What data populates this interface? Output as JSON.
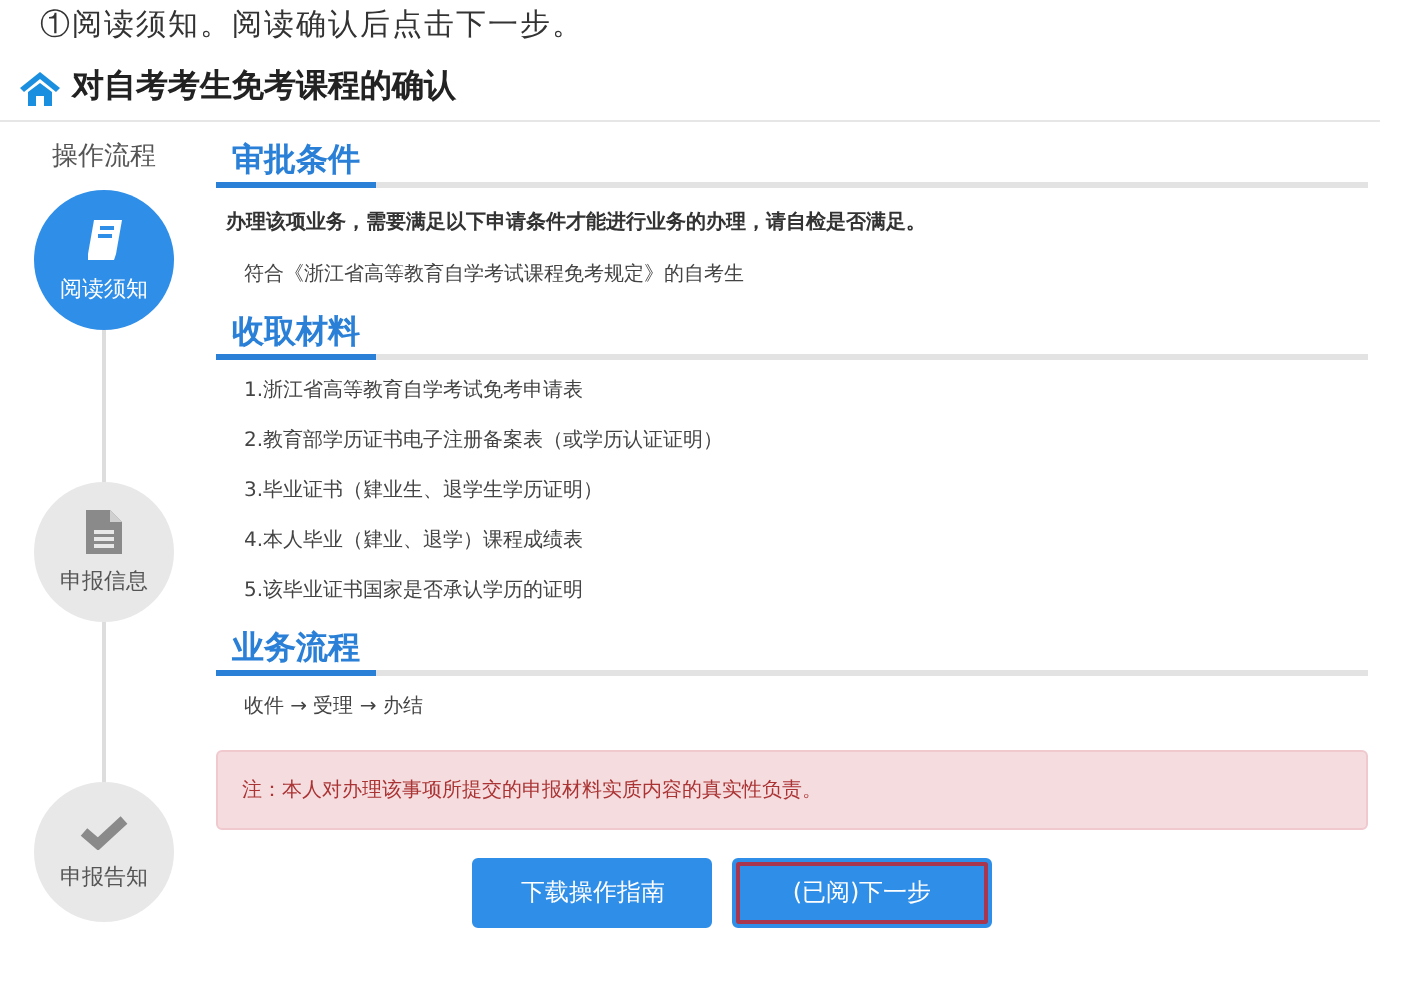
{
  "caption": "①阅读须知。阅读确认后点击下一步。",
  "page_title": "对自考考生免考课程的确认",
  "sidebar": {
    "title": "操作流程",
    "steps": [
      {
        "label": "阅读须知",
        "selected": true
      },
      {
        "label": "申报信息",
        "selected": false
      },
      {
        "label": "申报告知",
        "selected": false
      }
    ]
  },
  "sections": [
    {
      "heading": "审批条件",
      "lead": "办理该项业务，需要满足以下申请条件才能进行业务的办理，请自检是否满足。",
      "items": [
        "符合《浙江省高等教育自学考试课程免考规定》的自考生"
      ]
    },
    {
      "heading": "收取材料",
      "items": [
        "1.浙江省高等教育自学考试免考申请表",
        "2.教育部学历证书电子注册备案表（或学历认证证明）",
        "3.毕业证书（肄业生、退学生学历证明）",
        "4.本人毕业（肄业、退学）课程成绩表",
        "5.该毕业证书国家是否承认学历的证明"
      ]
    },
    {
      "heading": "业务流程",
      "items": [
        "收件 → 受理 → 办结"
      ]
    }
  ],
  "notice": "注：本人对办理该事项所提交的申报材料实质内容的真实性负责。",
  "buttons": [
    {
      "label": "下载操作指南",
      "highlighted": false
    },
    {
      "label": "(已阅)下一步",
      "highlighted": true
    }
  ]
}
